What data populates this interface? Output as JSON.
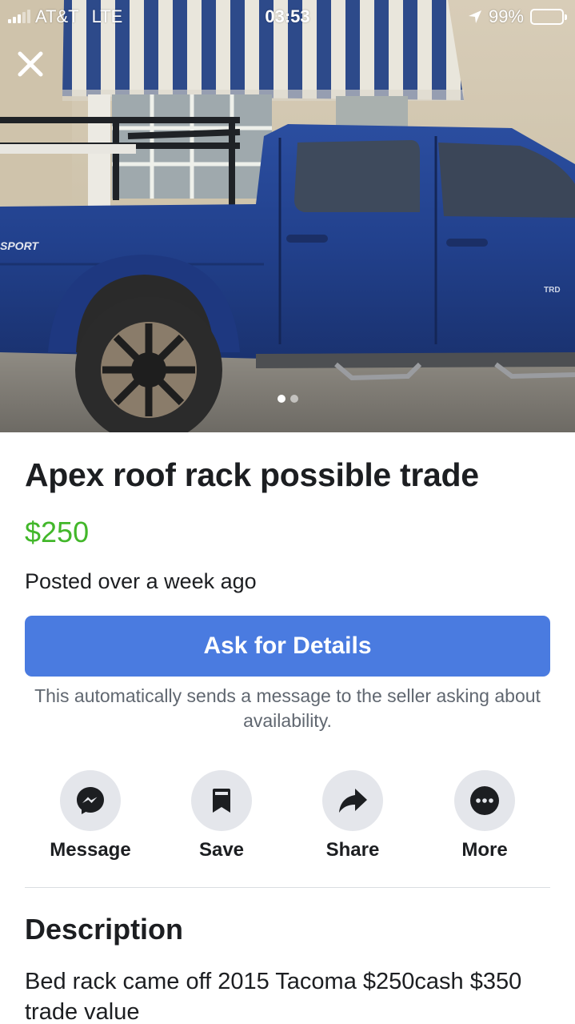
{
  "status_bar": {
    "carrier": "AT&T",
    "network": "LTE",
    "time": "03:53",
    "battery": "99%",
    "battery_level": 0.99
  },
  "photo": {
    "alt_subject": "blue pickup truck with bed rack",
    "page_count": 2,
    "current_page": 1
  },
  "listing": {
    "title": "Apex roof rack possible trade",
    "price": "$250",
    "posted": "Posted over a week ago"
  },
  "cta": {
    "ask_label": "Ask for Details",
    "note": "This automatically sends a message to the seller asking about availability."
  },
  "actions": [
    {
      "label": "Message",
      "icon": "messenger-icon"
    },
    {
      "label": "Save",
      "icon": "bookmark-icon"
    },
    {
      "label": "Share",
      "icon": "share-arrow-icon"
    },
    {
      "label": "More",
      "icon": "more-dots-icon"
    }
  ],
  "description": {
    "heading": "Description",
    "text": "Bed rack came off 2015 Tacoma $250cash $350 trade value"
  },
  "colors": {
    "price": "#42b72a",
    "button": "#4a7be0",
    "icon_circle": "#e4e6eb"
  }
}
